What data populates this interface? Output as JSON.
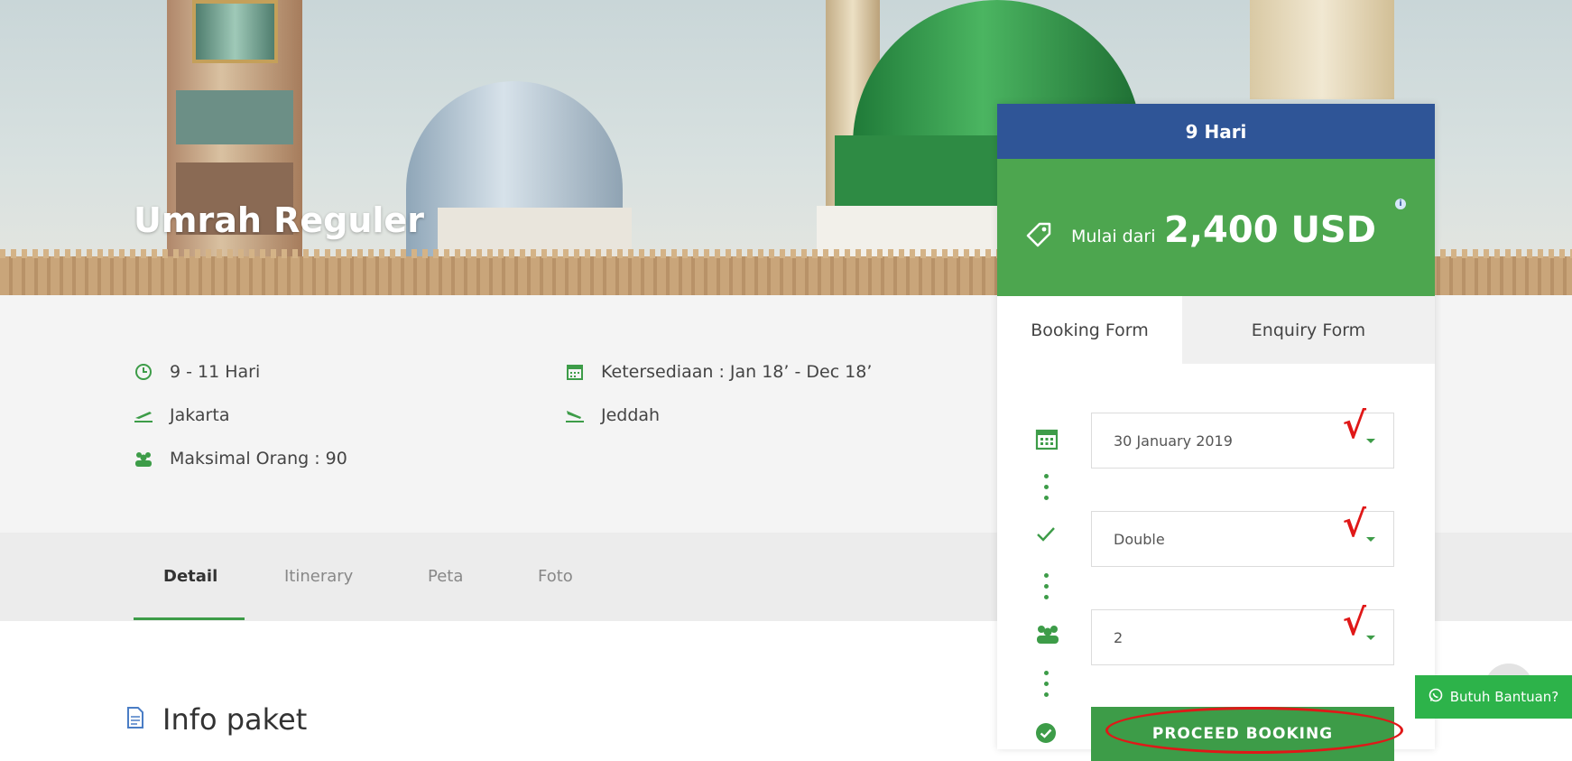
{
  "hero": {
    "title": "Umrah Reguler"
  },
  "details": {
    "duration": "9 - 11 Hari",
    "departure": "Jakarta",
    "max_people": "Maksimal Orang : 90",
    "availability": "Ketersediaan : Jan 18’ - Dec 18’",
    "arrival": "Jeddah"
  },
  "tabs": [
    {
      "label": "Detail",
      "active": true
    },
    {
      "label": "Itinerary",
      "active": false
    },
    {
      "label": "Peta",
      "active": false
    },
    {
      "label": "Foto",
      "active": false
    }
  ],
  "section": {
    "title": "Info paket"
  },
  "booking": {
    "days": "9 Hari",
    "price_prefix": "Mulai dari",
    "price": "2,400 USD",
    "form_tabs": [
      "Booking Form",
      "Enquiry Form"
    ],
    "date_value": "30 January 2019",
    "room_value": "Double",
    "people_value": "2",
    "proceed_label": "PROCEED BOOKING",
    "annotation_mark": "√"
  },
  "help": {
    "label": "Butuh Bantuan?"
  },
  "colors": {
    "primary_green": "#3d9c48",
    "navy": "#2f5597",
    "annotation_red": "#e01818"
  }
}
